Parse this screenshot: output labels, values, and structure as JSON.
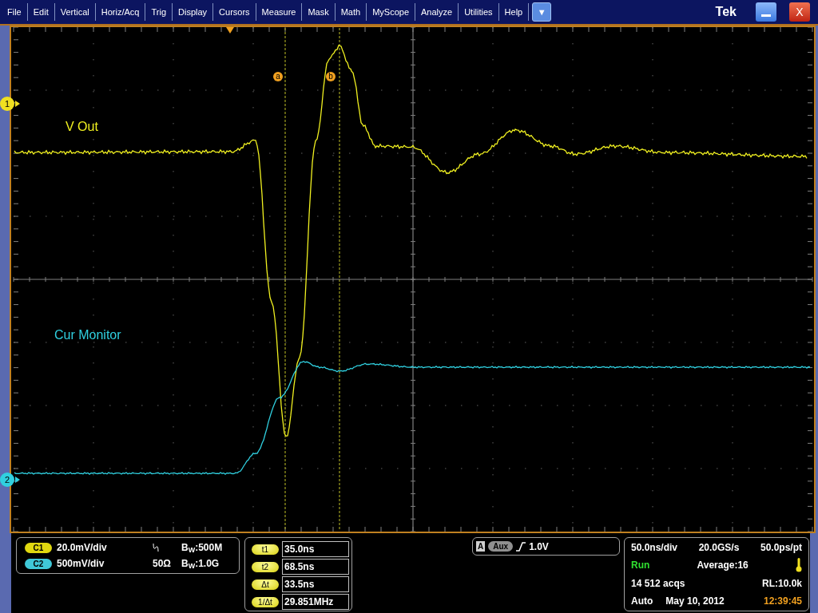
{
  "menu": [
    "File",
    "Edit",
    "Vertical",
    "Horiz/Acq",
    "Trig",
    "Display",
    "Cursors",
    "Measure",
    "Mask",
    "Math",
    "MyScope",
    "Analyze",
    "Utilities",
    "Help"
  ],
  "menu_dropdown": "▼",
  "brand": "Tek",
  "close_button": "X",
  "plot": {
    "trace_labels": [
      {
        "text": "V Out",
        "color": "#f0f020"
      },
      {
        "text": "Cur Monitor",
        "color": "#30d0e0"
      }
    ],
    "channel_markers": [
      {
        "text": "1",
        "color": "#f0e020"
      },
      {
        "text": "2",
        "color": "#30d0e0"
      }
    ],
    "cursor_markers": [
      "a",
      "b"
    ]
  },
  "channels": [
    {
      "badge": "C1",
      "color": "#e0d810",
      "scale": "20.0mV/div",
      "bandwidth": "B$_{W}$:500M"
    },
    {
      "badge": "C2",
      "color": "#40c8d8",
      "scale": "500mV/div",
      "termination": "50Ω",
      "bandwidth": "B$_{W}$:1.0G"
    }
  ],
  "cursors": [
    {
      "label": "t1",
      "value": "35.0ns"
    },
    {
      "label": "t2",
      "value": "68.5ns"
    },
    {
      "label": "Δt",
      "value": "33.5ns"
    },
    {
      "label": "1/Δt",
      "value": "29.851MHz"
    }
  ],
  "trigger": {
    "mode": "A",
    "source": "Aux",
    "level": "1.0V"
  },
  "timebase": {
    "scale": "50.0ns/div",
    "sample_rate": "20.0GS/s",
    "resolution": "50.0ps/pt",
    "state": "Run",
    "acquire_mode": "Average:16",
    "acqs": "14 512 acqs",
    "record_length": "RL:10.0k",
    "trigger_mode": "Auto",
    "date": "May 10, 2012",
    "time": "12:39:45"
  }
}
